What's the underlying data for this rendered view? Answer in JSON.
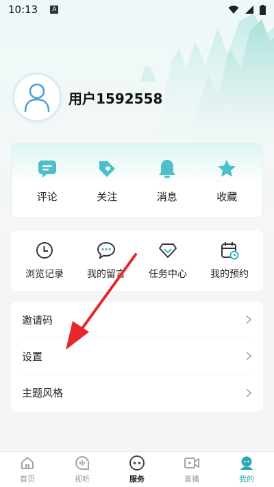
{
  "status_bar": {
    "time": "10:13",
    "indicator": "A"
  },
  "profile": {
    "username": "用户1592558"
  },
  "quick_actions": [
    {
      "label": "评论",
      "icon": "comment-icon"
    },
    {
      "label": "关注",
      "icon": "heart-tag-icon"
    },
    {
      "label": "消息",
      "icon": "bell-icon"
    },
    {
      "label": "收藏",
      "icon": "star-icon"
    }
  ],
  "tools": [
    {
      "label": "浏览记录",
      "icon": "clock-icon"
    },
    {
      "label": "我的留言",
      "icon": "message-icon"
    },
    {
      "label": "任务中心",
      "icon": "diamond-icon"
    },
    {
      "label": "我的预约",
      "icon": "calendar-icon"
    }
  ],
  "settings_list": [
    {
      "label": "邀请码"
    },
    {
      "label": "设置"
    },
    {
      "label": "主题风格"
    }
  ],
  "bottom_nav": [
    {
      "label": "首页",
      "icon": "home-icon"
    },
    {
      "label": "视听",
      "icon": "audio-icon"
    },
    {
      "label": "服务",
      "icon": "service-icon"
    },
    {
      "label": "直播",
      "icon": "video-icon"
    },
    {
      "label": "我的",
      "icon": "profile-icon"
    }
  ],
  "colors": {
    "accent": "#2ba9b3",
    "icon_teal": "#3bb4c1",
    "arrow_red": "#e8262a"
  }
}
